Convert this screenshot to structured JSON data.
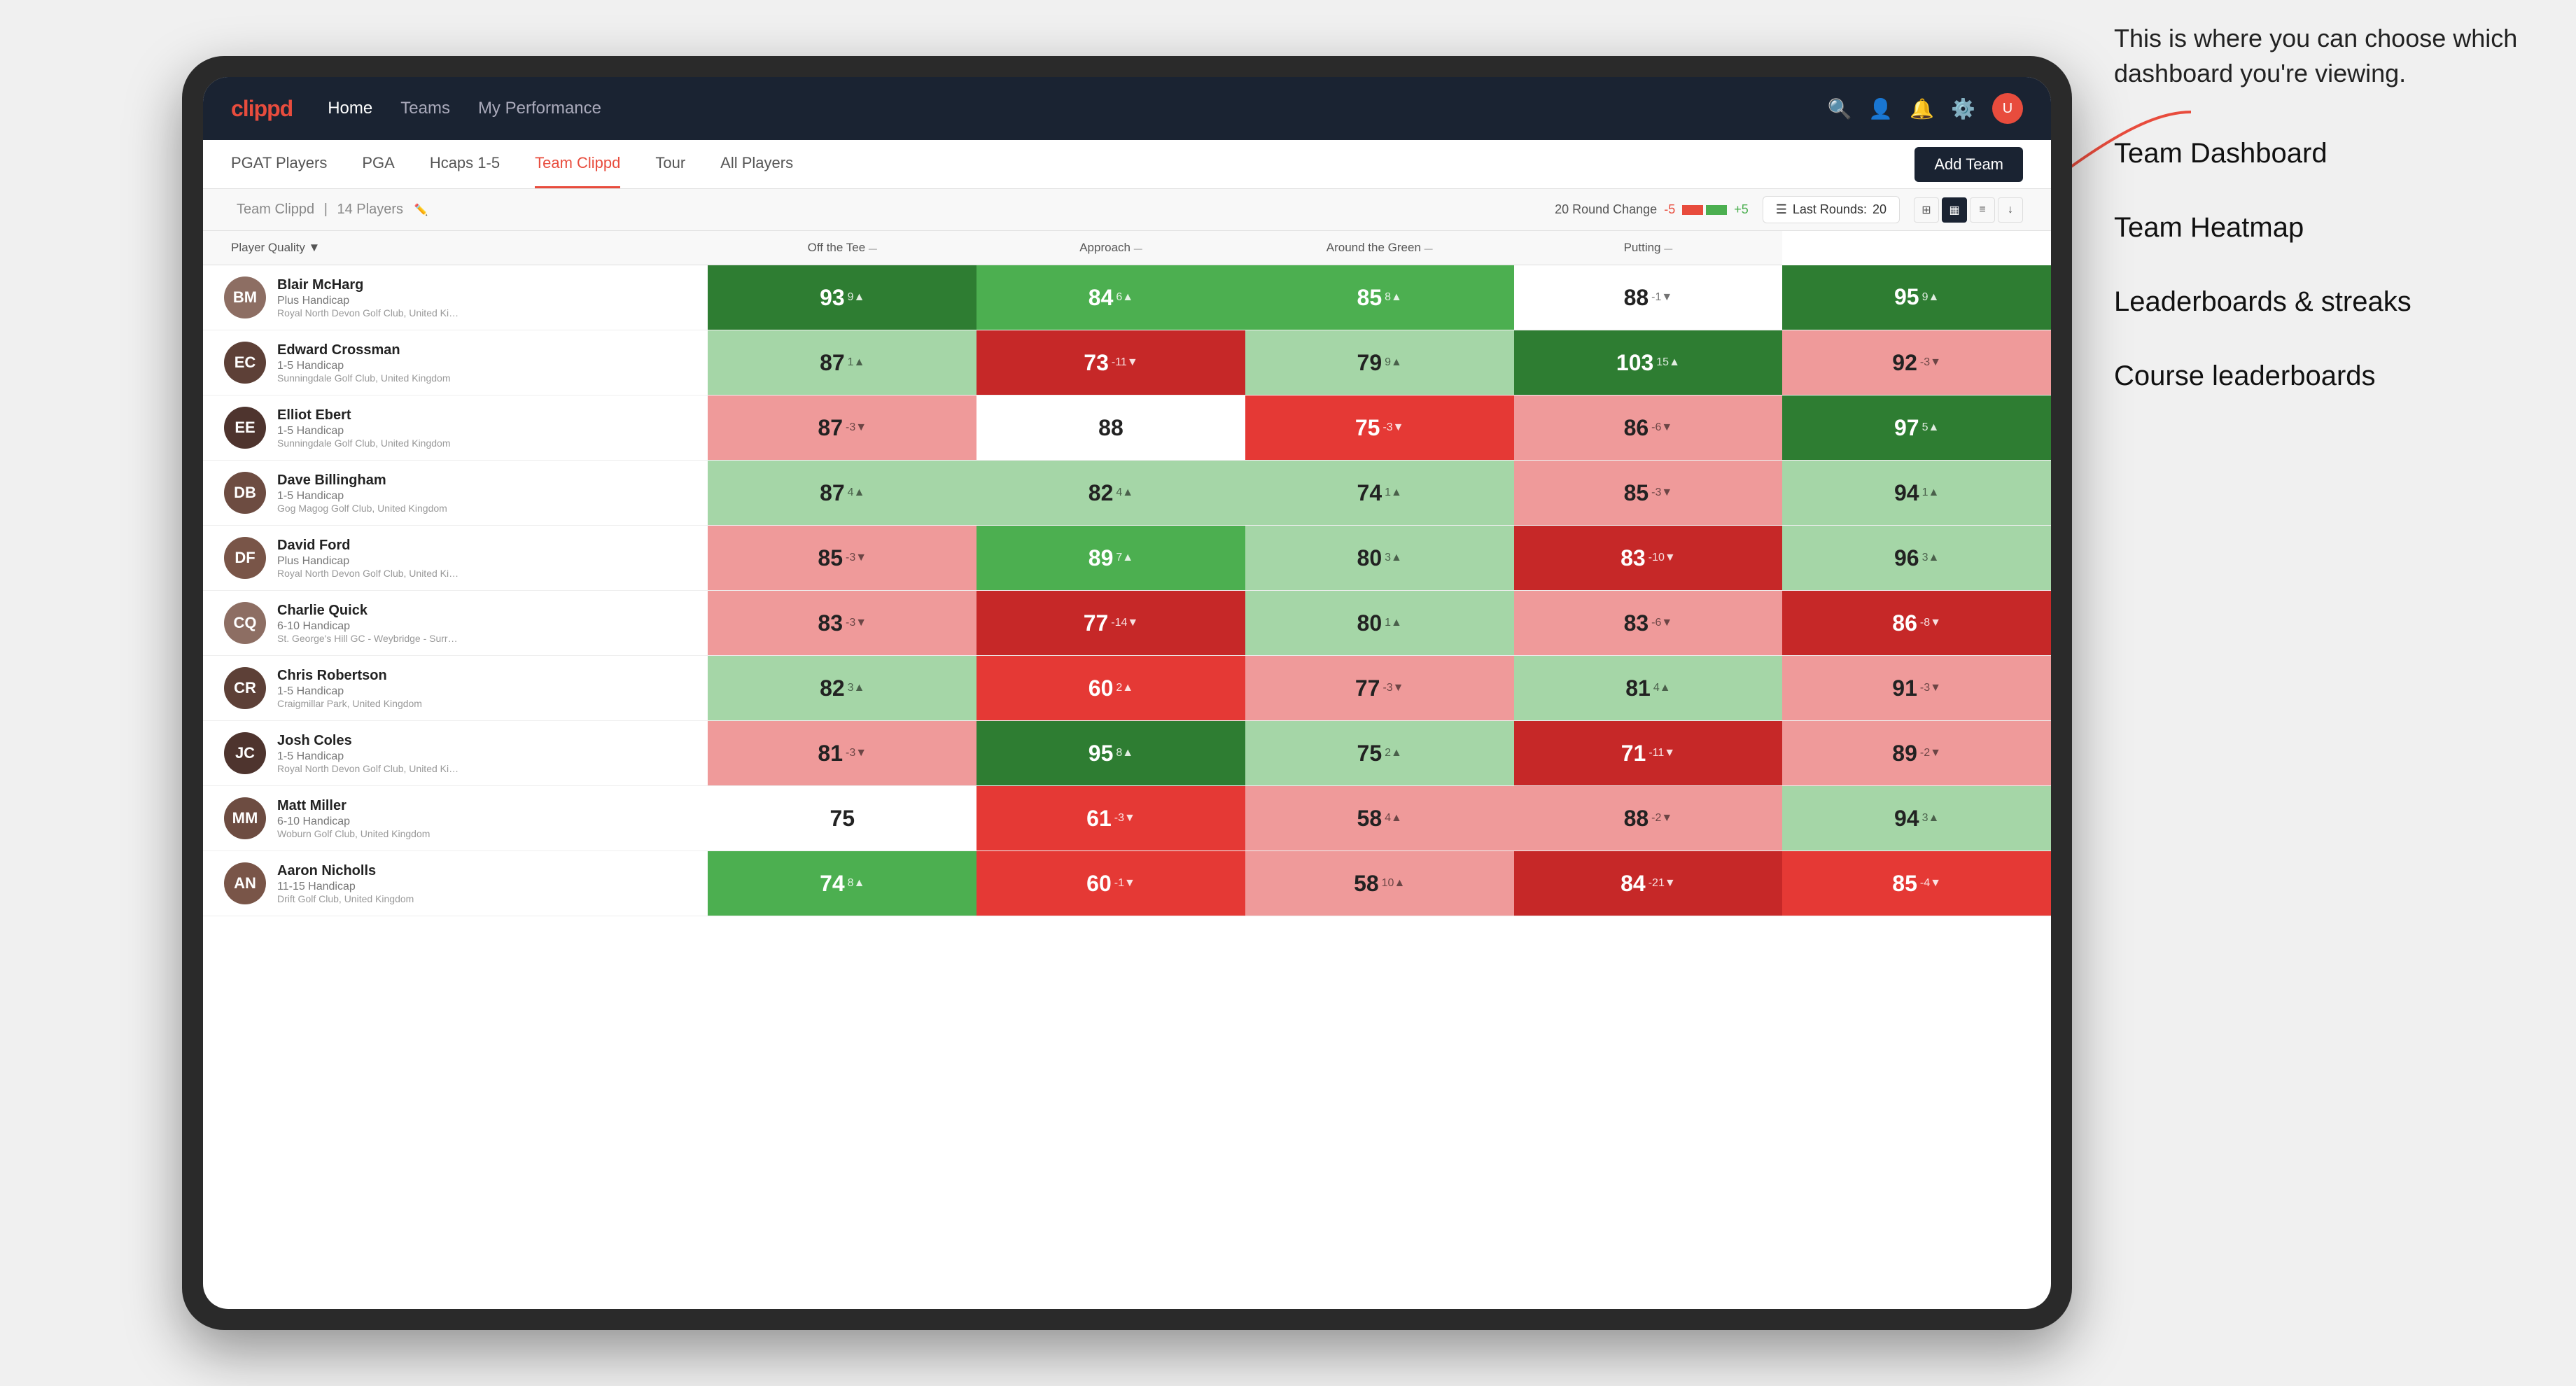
{
  "annotation": {
    "intro": "This is where you can choose which dashboard you're viewing.",
    "items": [
      "Team Dashboard",
      "Team Heatmap",
      "Leaderboards & streaks",
      "Course leaderboards"
    ]
  },
  "navbar": {
    "logo": "clippd",
    "nav_items": [
      "Home",
      "Teams",
      "My Performance"
    ],
    "active_nav": "Home"
  },
  "subnav": {
    "tabs": [
      "PGAT Players",
      "PGA",
      "Hcaps 1-5",
      "Team Clippd",
      "Tour",
      "All Players"
    ],
    "active_tab": "Team Clippd",
    "add_team_label": "Add Team"
  },
  "team_header": {
    "team_name": "Team Clippd",
    "player_count": "14 Players",
    "round_change_label": "20 Round Change",
    "neg_val": "-5",
    "pos_val": "+5",
    "last_rounds_label": "Last Rounds:",
    "last_rounds_num": "20"
  },
  "table": {
    "columns": [
      {
        "label": "Player Quality",
        "key": "player_quality",
        "has_arrow": true
      },
      {
        "label": "Off the Tee",
        "key": "off_tee",
        "has_arrow": true
      },
      {
        "label": "Approach",
        "key": "approach",
        "has_arrow": true
      },
      {
        "label": "Around the Green",
        "key": "around_green",
        "has_arrow": true
      },
      {
        "label": "Putting",
        "key": "putting",
        "has_arrow": true
      }
    ],
    "players": [
      {
        "name": "Blair McHarg",
        "handicap": "Plus Handicap",
        "club": "Royal North Devon Golf Club, United Kingdom",
        "avatar_color": "#8d6e63",
        "initials": "BM",
        "player_quality": {
          "score": "93",
          "change": "9▲",
          "bg": "green-dark",
          "white": true
        },
        "off_tee": {
          "score": "84",
          "change": "6▲",
          "bg": "green-med",
          "white": true
        },
        "approach": {
          "score": "85",
          "change": "8▲",
          "bg": "green-med",
          "white": true
        },
        "around_green": {
          "score": "88",
          "change": "-1▼",
          "bg": "white",
          "white": false
        },
        "putting": {
          "score": "95",
          "change": "9▲",
          "bg": "green-dark",
          "white": true
        }
      },
      {
        "name": "Edward Crossman",
        "handicap": "1-5 Handicap",
        "club": "Sunningdale Golf Club, United Kingdom",
        "avatar_color": "#5d4037",
        "initials": "EC",
        "player_quality": {
          "score": "87",
          "change": "1▲",
          "bg": "green-light",
          "white": false
        },
        "off_tee": {
          "score": "73",
          "change": "-11▼",
          "bg": "red-dark",
          "white": true
        },
        "approach": {
          "score": "79",
          "change": "9▲",
          "bg": "green-light",
          "white": false
        },
        "around_green": {
          "score": "103",
          "change": "15▲",
          "bg": "green-dark",
          "white": true
        },
        "putting": {
          "score": "92",
          "change": "-3▼",
          "bg": "red-light",
          "white": false
        }
      },
      {
        "name": "Elliot Ebert",
        "handicap": "1-5 Handicap",
        "club": "Sunningdale Golf Club, United Kingdom",
        "avatar_color": "#4e342e",
        "initials": "EE",
        "player_quality": {
          "score": "87",
          "change": "-3▼",
          "bg": "red-light",
          "white": false
        },
        "off_tee": {
          "score": "88",
          "change": "",
          "bg": "white",
          "white": false
        },
        "approach": {
          "score": "75",
          "change": "-3▼",
          "bg": "red-med",
          "white": true
        },
        "around_green": {
          "score": "86",
          "change": "-6▼",
          "bg": "red-light",
          "white": false
        },
        "putting": {
          "score": "97",
          "change": "5▲",
          "bg": "green-dark",
          "white": true
        }
      },
      {
        "name": "Dave Billingham",
        "handicap": "1-5 Handicap",
        "club": "Gog Magog Golf Club, United Kingdom",
        "avatar_color": "#6d4c41",
        "initials": "DB",
        "player_quality": {
          "score": "87",
          "change": "4▲",
          "bg": "green-light",
          "white": false
        },
        "off_tee": {
          "score": "82",
          "change": "4▲",
          "bg": "green-light",
          "white": false
        },
        "approach": {
          "score": "74",
          "change": "1▲",
          "bg": "green-light",
          "white": false
        },
        "around_green": {
          "score": "85",
          "change": "-3▼",
          "bg": "red-light",
          "white": false
        },
        "putting": {
          "score": "94",
          "change": "1▲",
          "bg": "green-light",
          "white": false
        }
      },
      {
        "name": "David Ford",
        "handicap": "Plus Handicap",
        "club": "Royal North Devon Golf Club, United Kingdom",
        "avatar_color": "#795548",
        "initials": "DF",
        "player_quality": {
          "score": "85",
          "change": "-3▼",
          "bg": "red-light",
          "white": false
        },
        "off_tee": {
          "score": "89",
          "change": "7▲",
          "bg": "green-med",
          "white": true
        },
        "approach": {
          "score": "80",
          "change": "3▲",
          "bg": "green-light",
          "white": false
        },
        "around_green": {
          "score": "83",
          "change": "-10▼",
          "bg": "red-dark",
          "white": true
        },
        "putting": {
          "score": "96",
          "change": "3▲",
          "bg": "green-light",
          "white": false
        }
      },
      {
        "name": "Charlie Quick",
        "handicap": "6-10 Handicap",
        "club": "St. George's Hill GC - Weybridge - Surrey, Uni...",
        "avatar_color": "#8d6e63",
        "initials": "CQ",
        "player_quality": {
          "score": "83",
          "change": "-3▼",
          "bg": "red-light",
          "white": false
        },
        "off_tee": {
          "score": "77",
          "change": "-14▼",
          "bg": "red-dark",
          "white": true
        },
        "approach": {
          "score": "80",
          "change": "1▲",
          "bg": "green-light",
          "white": false
        },
        "around_green": {
          "score": "83",
          "change": "-6▼",
          "bg": "red-light",
          "white": false
        },
        "putting": {
          "score": "86",
          "change": "-8▼",
          "bg": "red-dark",
          "white": true
        }
      },
      {
        "name": "Chris Robertson",
        "handicap": "1-5 Handicap",
        "club": "Craigmillar Park, United Kingdom",
        "avatar_color": "#5d4037",
        "initials": "CR",
        "player_quality": {
          "score": "82",
          "change": "3▲",
          "bg": "green-light",
          "white": false
        },
        "off_tee": {
          "score": "60",
          "change": "2▲",
          "bg": "red-med",
          "white": true
        },
        "approach": {
          "score": "77",
          "change": "-3▼",
          "bg": "red-light",
          "white": false
        },
        "around_green": {
          "score": "81",
          "change": "4▲",
          "bg": "green-light",
          "white": false
        },
        "putting": {
          "score": "91",
          "change": "-3▼",
          "bg": "red-light",
          "white": false
        }
      },
      {
        "name": "Josh Coles",
        "handicap": "1-5 Handicap",
        "club": "Royal North Devon Golf Club, United Kingdom",
        "avatar_color": "#4e342e",
        "initials": "JC",
        "player_quality": {
          "score": "81",
          "change": "-3▼",
          "bg": "red-light",
          "white": false
        },
        "off_tee": {
          "score": "95",
          "change": "8▲",
          "bg": "green-dark",
          "white": true
        },
        "approach": {
          "score": "75",
          "change": "2▲",
          "bg": "green-light",
          "white": false
        },
        "around_green": {
          "score": "71",
          "change": "-11▼",
          "bg": "red-dark",
          "white": true
        },
        "putting": {
          "score": "89",
          "change": "-2▼",
          "bg": "red-light",
          "white": false
        }
      },
      {
        "name": "Matt Miller",
        "handicap": "6-10 Handicap",
        "club": "Woburn Golf Club, United Kingdom",
        "avatar_color": "#6d4c41",
        "initials": "MM",
        "player_quality": {
          "score": "75",
          "change": "",
          "bg": "white",
          "white": false
        },
        "off_tee": {
          "score": "61",
          "change": "-3▼",
          "bg": "red-med",
          "white": true
        },
        "approach": {
          "score": "58",
          "change": "4▲",
          "bg": "red-light",
          "white": false
        },
        "around_green": {
          "score": "88",
          "change": "-2▼",
          "bg": "red-light",
          "white": false
        },
        "putting": {
          "score": "94",
          "change": "3▲",
          "bg": "green-light",
          "white": false
        }
      },
      {
        "name": "Aaron Nicholls",
        "handicap": "11-15 Handicap",
        "club": "Drift Golf Club, United Kingdom",
        "avatar_color": "#795548",
        "initials": "AN",
        "player_quality": {
          "score": "74",
          "change": "8▲",
          "bg": "green-med",
          "white": true
        },
        "off_tee": {
          "score": "60",
          "change": "-1▼",
          "bg": "red-med",
          "white": true
        },
        "approach": {
          "score": "58",
          "change": "10▲",
          "bg": "red-light",
          "white": false
        },
        "around_green": {
          "score": "84",
          "change": "-21▼",
          "bg": "red-dark",
          "white": true
        },
        "putting": {
          "score": "85",
          "change": "-4▼",
          "bg": "red-med",
          "white": true
        }
      }
    ]
  },
  "colors": {
    "green_dark": "#2e7d32",
    "green_med": "#4caf50",
    "green_light": "#a5d6a7",
    "red_dark": "#c62828",
    "red_med": "#e53935",
    "red_light": "#ef9a9a",
    "white": "#ffffff",
    "navbar_bg": "#1a2332",
    "brand_red": "#e84c3d"
  }
}
